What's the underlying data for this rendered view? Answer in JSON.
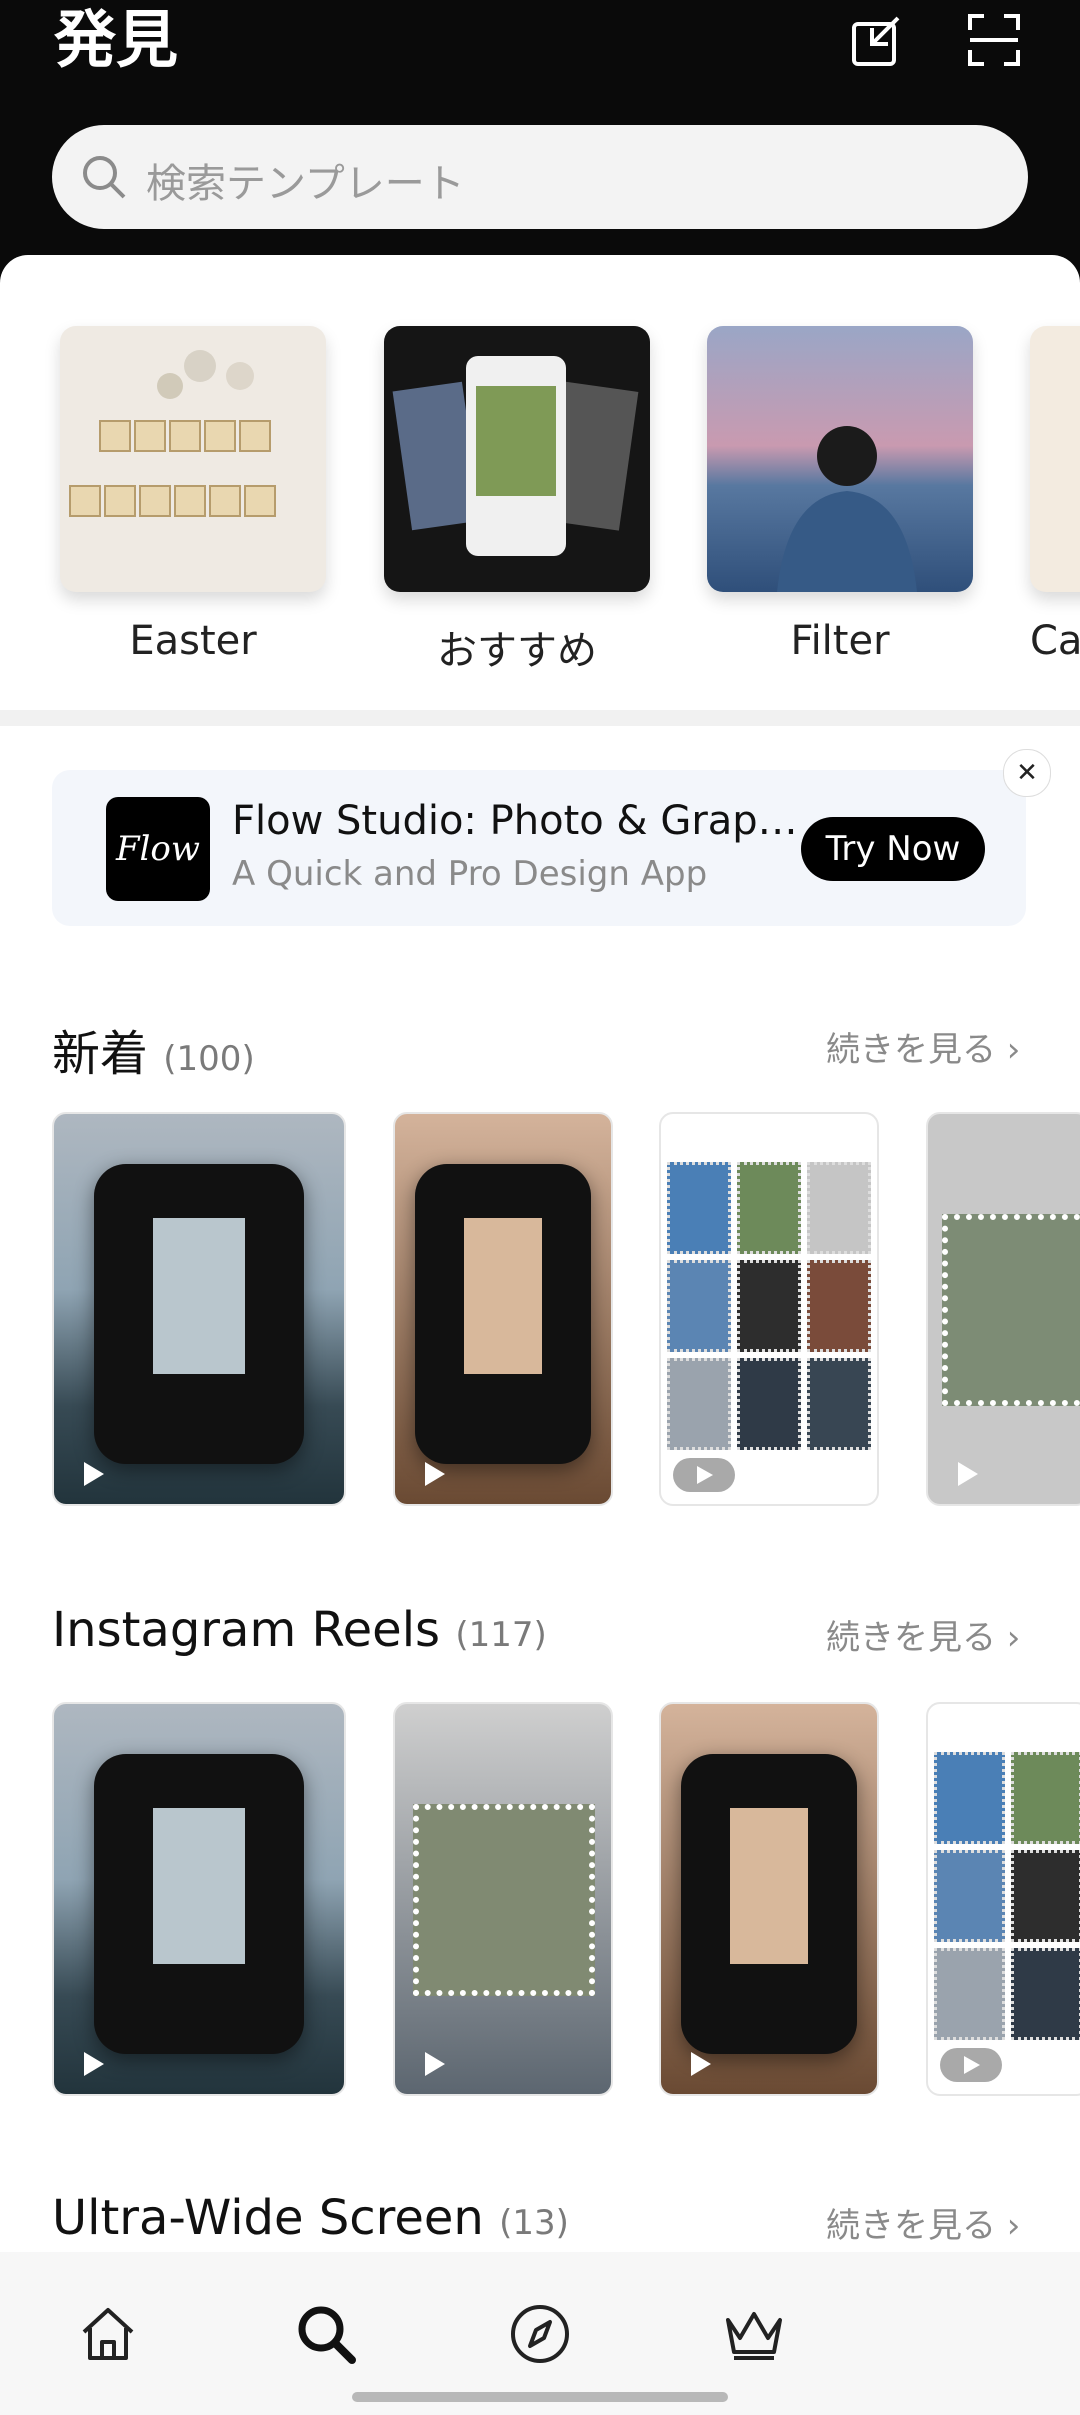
{
  "header": {
    "title": "発見"
  },
  "search": {
    "placeholder": "検索テンプレート"
  },
  "categories": [
    {
      "label": "Easter"
    },
    {
      "label": "おすすめ"
    },
    {
      "label": "Filter"
    },
    {
      "label": "Ca"
    }
  ],
  "ad": {
    "logo_text": "Flow",
    "title": "Flow Studio: Photo & Grap…",
    "subtitle": "A Quick and Pro Design App",
    "cta": "Try Now",
    "close": "✕"
  },
  "sections": [
    {
      "title": "新着",
      "count": "(100)",
      "see_all": "続きを見る ›"
    },
    {
      "title": "Instagram Reels",
      "count": "(117)",
      "see_all": "続きを見る ›"
    },
    {
      "title": "Ultra-Wide Screen",
      "count": "(13)",
      "see_all": "続きを見る ›"
    }
  ],
  "tabs": [
    "home-icon",
    "search-icon",
    "compass-icon",
    "crown-icon"
  ]
}
